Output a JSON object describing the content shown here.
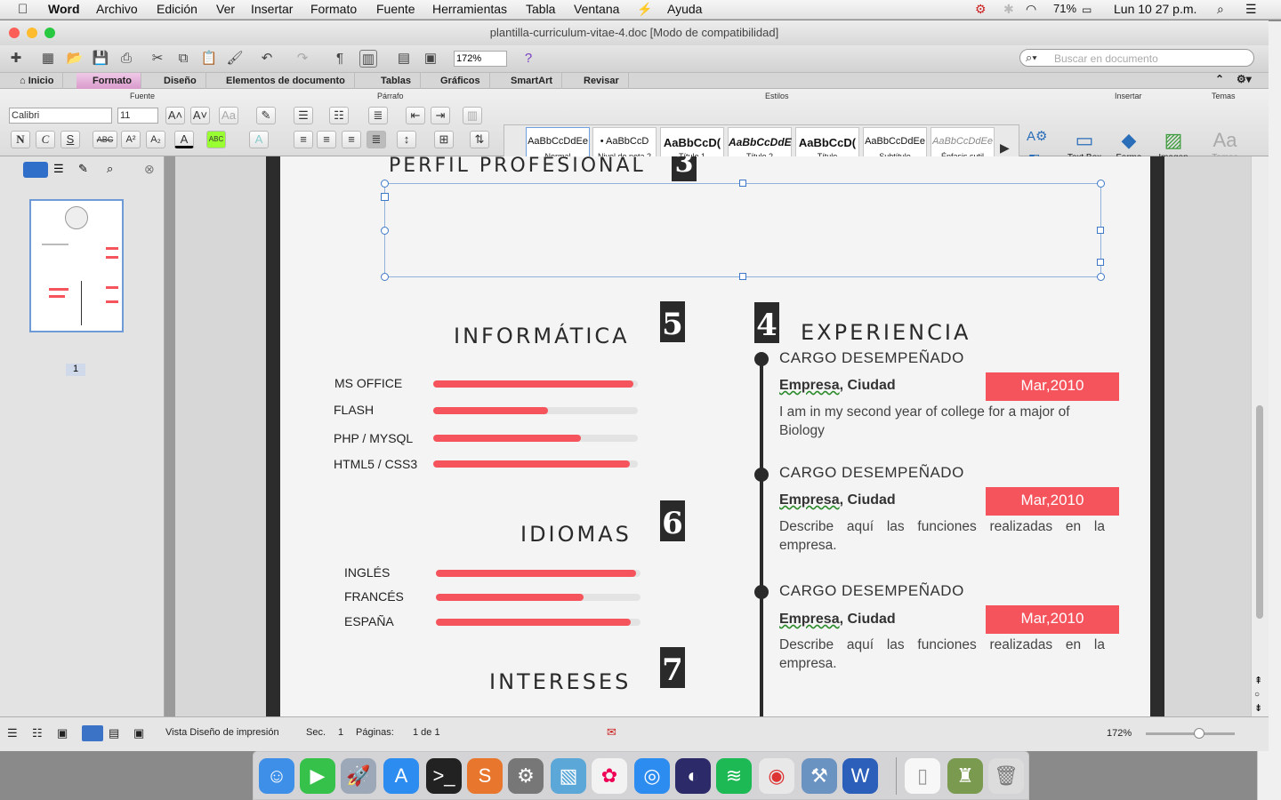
{
  "menubar": {
    "apple": "",
    "app": "Word",
    "items": [
      "Archivo",
      "Edición",
      "Ver",
      "Insertar",
      "Formato",
      "Fuente",
      "Herramientas",
      "Tabla",
      "Ventana",
      "Ayuda"
    ],
    "battery": "71%",
    "clock": "Lun 10 27 p.m."
  },
  "window": {
    "title": "plantilla-curriculum-vitae-4.doc [Modo de compatibilidad]",
    "zoom": "172%",
    "search_placeholder": "Buscar en documento"
  },
  "tabs": [
    "Inicio",
    "Formato",
    "Diseño",
    "Elementos de documento",
    "Tablas",
    "Gráficos",
    "SmartArt",
    "Revisar"
  ],
  "ribbon": {
    "groups": {
      "fuente": "Fuente",
      "parrafo": "Párrafo",
      "estilos": "Estilos",
      "insertar": "Insertar",
      "temas": "Temas"
    },
    "font": "Calibri",
    "size": "11",
    "fmt": {
      "bold": "N",
      "italic": "C",
      "underline": "S",
      "strike": "ABC",
      "sup": "A²",
      "sub": "A₂"
    },
    "styles": [
      {
        "preview": "AaBbCcDdEe",
        "name": "Normal"
      },
      {
        "preview": "• AaBbCcD",
        "name": "Nivel de nota 2"
      },
      {
        "preview": "AaBbCcD(",
        "name": "Título 1"
      },
      {
        "preview": "AaBbCcDdE",
        "name": "Título 2"
      },
      {
        "preview": "AaBbCcD(",
        "name": "Título"
      },
      {
        "preview": "AaBbCcDdEe",
        "name": "Subtítulo"
      },
      {
        "preview": "AaBbCcDdEe",
        "name": "Énfasis sutil"
      }
    ],
    "insert": [
      "Text Box",
      "Forma",
      "Imagen"
    ],
    "themes": "Temas"
  },
  "sidebar": {
    "page_label": "1"
  },
  "doc": {
    "perfil": "PERFIL PROFESIONAL",
    "perfil_num": "3",
    "informatica": "INFORMÁTICA",
    "informatica_num": "5",
    "skills": [
      {
        "label": "MS OFFICE",
        "level": 0.98
      },
      {
        "label": "FLASH",
        "level": 0.56
      },
      {
        "label": "PHP / MYSQL",
        "level": 0.72
      },
      {
        "label": "HTML5 / CSS3",
        "level": 0.96
      }
    ],
    "idiomas": "IDIOMAS",
    "idiomas_num": "6",
    "langs": [
      {
        "label": "INGLÉS",
        "level": 0.98
      },
      {
        "label": "FRANCÉS",
        "level": 0.72
      },
      {
        "label": "ESPAÑA",
        "level": 0.95
      }
    ],
    "intereses": "INTERESES",
    "intereses_num": "7",
    "experiencia": "EXPERIENCIA",
    "experiencia_num": "4",
    "jobs": [
      {
        "cargo": "CARGO DESEMPEÑADO",
        "empresa": "Empresa",
        "ciudad": ", Ciudad",
        "fecha": "Mar,2010",
        "desc": "I am in my second year of college for a major of Biology"
      },
      {
        "cargo": "CARGO DESEMPEÑADO",
        "empresa": "Empresa",
        "ciudad": ", Ciudad",
        "fecha": "Mar,2010",
        "desc": "Describe aquí las funciones realizadas en la empresa."
      },
      {
        "cargo": "CARGO DESEMPEÑADO",
        "empresa": "Empresa",
        "ciudad": ", Ciudad",
        "fecha": "Mar,2010",
        "desc": "Describe aquí las funciones realizadas en la empresa."
      }
    ]
  },
  "status": {
    "view": "Vista Diseño de impresión",
    "sec_label": "Sec.",
    "sec": "1",
    "pages_label": "Páginas:",
    "pages": "1 de 1",
    "zoom": "172%"
  },
  "colors": {
    "accent": "#f5545c",
    "dark": "#2a2a2a",
    "ribbon_active": "#e4a3d6"
  }
}
